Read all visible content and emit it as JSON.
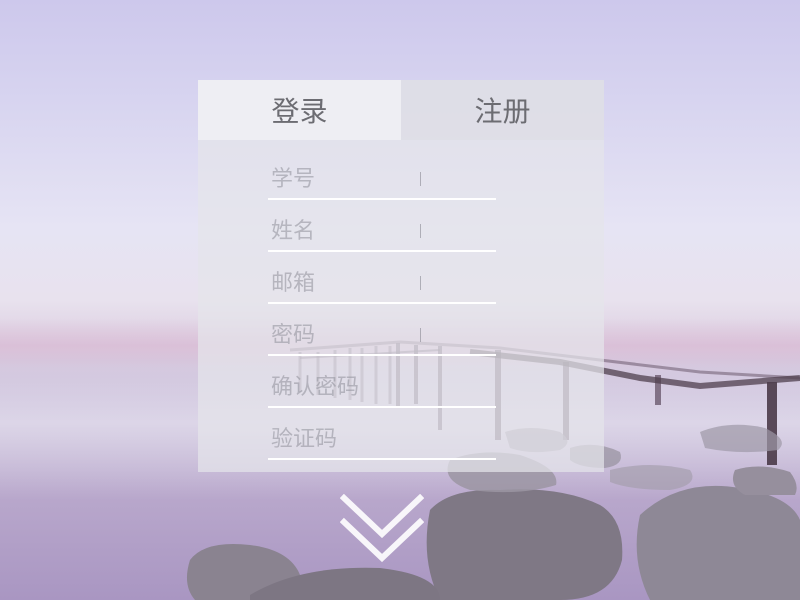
{
  "tabs": {
    "login_label": "登录",
    "register_label": "注册",
    "active": "login"
  },
  "form": {
    "fields": [
      {
        "name": "student-id",
        "placeholder": "学号",
        "value": ""
      },
      {
        "name": "name",
        "placeholder": "姓名",
        "value": ""
      },
      {
        "name": "email",
        "placeholder": "邮箱",
        "value": ""
      },
      {
        "name": "password",
        "placeholder": "密码",
        "value": ""
      },
      {
        "name": "confirm-password",
        "placeholder": "确认密码",
        "value": ""
      },
      {
        "name": "captcha",
        "placeholder": "验证码",
        "value": ""
      }
    ]
  },
  "scroll_hint": {
    "icon": "double-chevron-down-icon",
    "color": "#ffffff"
  },
  "colors": {
    "tab_text": "#6c6c72",
    "underline": "#ffffff"
  }
}
